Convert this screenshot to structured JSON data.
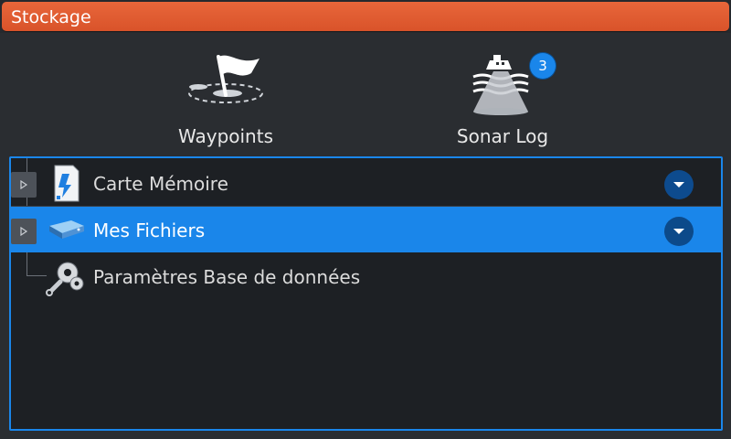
{
  "window": {
    "title": "Stockage"
  },
  "shortcuts": [
    {
      "label": "Waypoints",
      "icon": "waypoint-flag-icon"
    },
    {
      "label": "Sonar Log",
      "icon": "sonar-log-icon",
      "badge": "3"
    }
  ],
  "tree": {
    "items": [
      {
        "label": "Carte Mémoire",
        "icon": "memory-card-icon",
        "expandable": true,
        "selected": false
      },
      {
        "label": "Mes Fichiers",
        "icon": "drive-icon",
        "expandable": true,
        "selected": true
      },
      {
        "label": "Paramètres Base de données",
        "icon": "settings-gears-icon",
        "expandable": false,
        "selected": false
      }
    ]
  },
  "colors": {
    "titlebar": "#d9532a",
    "accent": "#1a86ea",
    "background": "#2a2d31"
  }
}
